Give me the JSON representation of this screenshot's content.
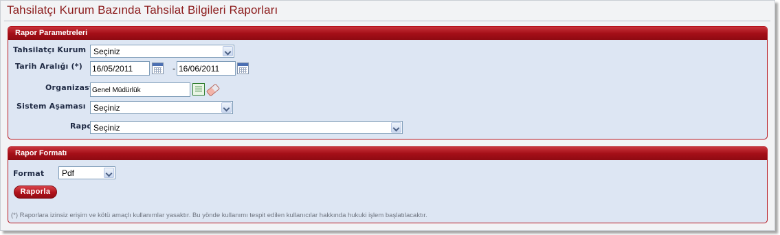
{
  "page": {
    "title": "Tahsilatçı Kurum Bazında Tahsilat Bilgileri Raporları"
  },
  "params_panel": {
    "header": "Rapor Parametreleri",
    "collector_label": "Tahsilatçı Kurum",
    "collector_value": "Seçiniz",
    "date_range_label": "Tarih Aralığı (*)",
    "date_start": "16/05/2011",
    "date_separator": "-",
    "date_end": "16/06/2011",
    "organization_label": "Organizasyon",
    "organization_value": "Genel Müdürlük",
    "system_stage_label": "Sistem Aşaması",
    "system_stage_value": "Seçiniz",
    "report_label": "Rapor",
    "report_value": "Seçiniz"
  },
  "format_panel": {
    "header": "Rapor Formatı",
    "format_label": "Format",
    "format_value": "Pdf",
    "submit_label": "Raporla",
    "footnote": "(*) Raporlara izinsiz erişim ve kötü amaçlı kullanımlar yasaktır. Bu yönde kullanımı tespit edilen kullanıcılar hakkında hukuki işlem başlatılacaktır."
  },
  "colors": {
    "accent": "#a50f18",
    "panel_bg": "#dde6f3",
    "title": "#8b1a1a"
  },
  "icons": {
    "calendar": "calendar-icon",
    "list": "list-select-icon",
    "eraser": "eraser-icon",
    "dropdown": "chevron-down-icon"
  }
}
